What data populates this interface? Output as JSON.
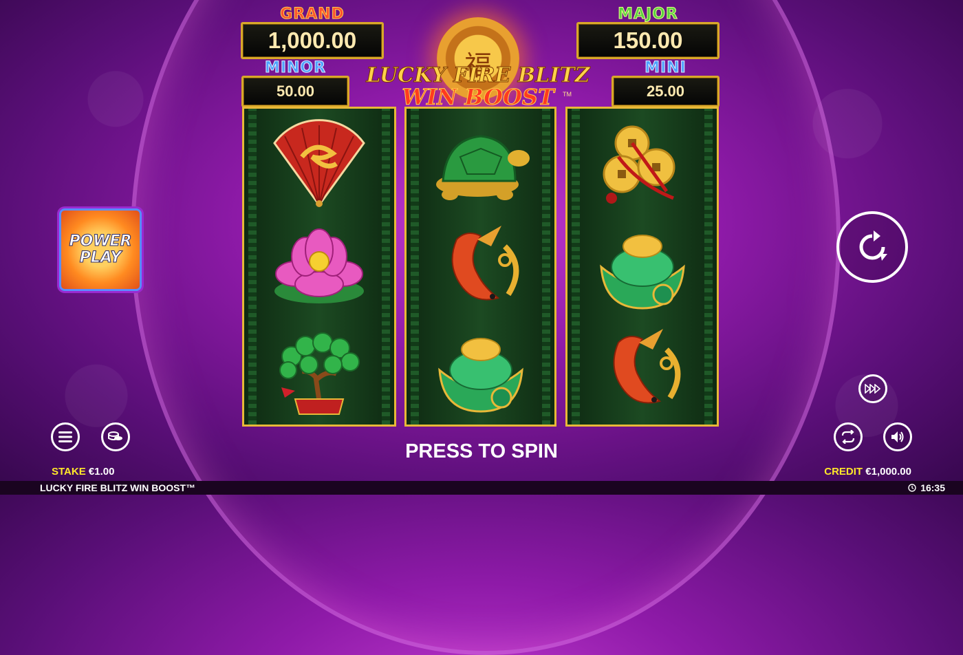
{
  "game_title": "LUCKY FIRE BLITZ WIN BOOST™",
  "logo": {
    "line1": "LUCKY FIRE BLITZ",
    "line2": "WIN BOOST",
    "tm": "TM"
  },
  "jackpots": {
    "grand": {
      "label": "GRAND",
      "value": "1,000.00"
    },
    "major": {
      "label": "MAJOR",
      "value": "150.00"
    },
    "minor": {
      "label": "MINOR",
      "value": "50.00"
    },
    "mini": {
      "label": "MINI",
      "value": "25.00"
    }
  },
  "reels": [
    [
      "fan",
      "lotus",
      "money-tree"
    ],
    [
      "turtle",
      "koi",
      "ingot"
    ],
    [
      "coins",
      "ingot",
      "koi"
    ]
  ],
  "power_play": {
    "line1": "POWER",
    "line2": "PLAY"
  },
  "press_to_spin": "PRESS TO SPIN",
  "stake": {
    "label": "STAKE",
    "value": "€1.00"
  },
  "credit": {
    "label": "CREDIT",
    "value": "€1,000.00"
  },
  "clock": "16:35",
  "colors": {
    "reel_border": "#e8b838",
    "background": "#8e1aa8",
    "highlight": "#ffe82a"
  }
}
